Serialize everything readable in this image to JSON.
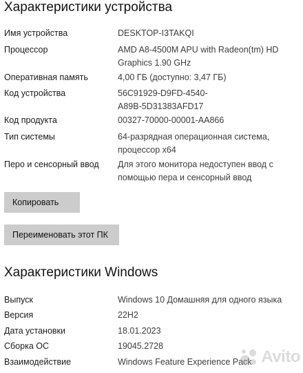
{
  "device_section": {
    "heading": "Характеристики устройства",
    "rows": [
      {
        "label": "Имя устройства",
        "value": "DESKTOP-I3TAKQI"
      },
      {
        "label": "Процессор",
        "value": "AMD A8-4500M APU with Radeon(tm) HD Graphics      1.90 GHz"
      },
      {
        "label": "Оперативная память",
        "value": "4,00 ГБ (доступно: 3,47 ГБ)"
      },
      {
        "label": "Код устройства",
        "value": "56C91929-D9FD-4540-A89B-5D31383AFD17"
      },
      {
        "label": "Код продукта",
        "value": "00327-70000-00001-AA866"
      },
      {
        "label": "Тип системы",
        "value": "64-разрядная операционная система, процессор x64"
      },
      {
        "label": "Перо и сенсорный ввод",
        "value": "Для этого монитора недоступен ввод с помощью пера и сенсорный ввод"
      }
    ],
    "copy_button": "Копировать",
    "rename_button": "Переименовать этот ПК"
  },
  "windows_section": {
    "heading": "Характеристики Windows",
    "rows": [
      {
        "label": "Выпуск",
        "value": "Windows 10 Домашняя для одного языка"
      },
      {
        "label": "Версия",
        "value": "22H2"
      },
      {
        "label": "Дата установки",
        "value": "18.01.2023"
      },
      {
        "label": "Сборка ОС",
        "value": "19045.2728"
      },
      {
        "label": "Взаимодействие",
        "value": "Windows Feature Experience Pack"
      }
    ]
  },
  "watermark": {
    "text": "Avito",
    "icon": "avito-logo-icon"
  }
}
